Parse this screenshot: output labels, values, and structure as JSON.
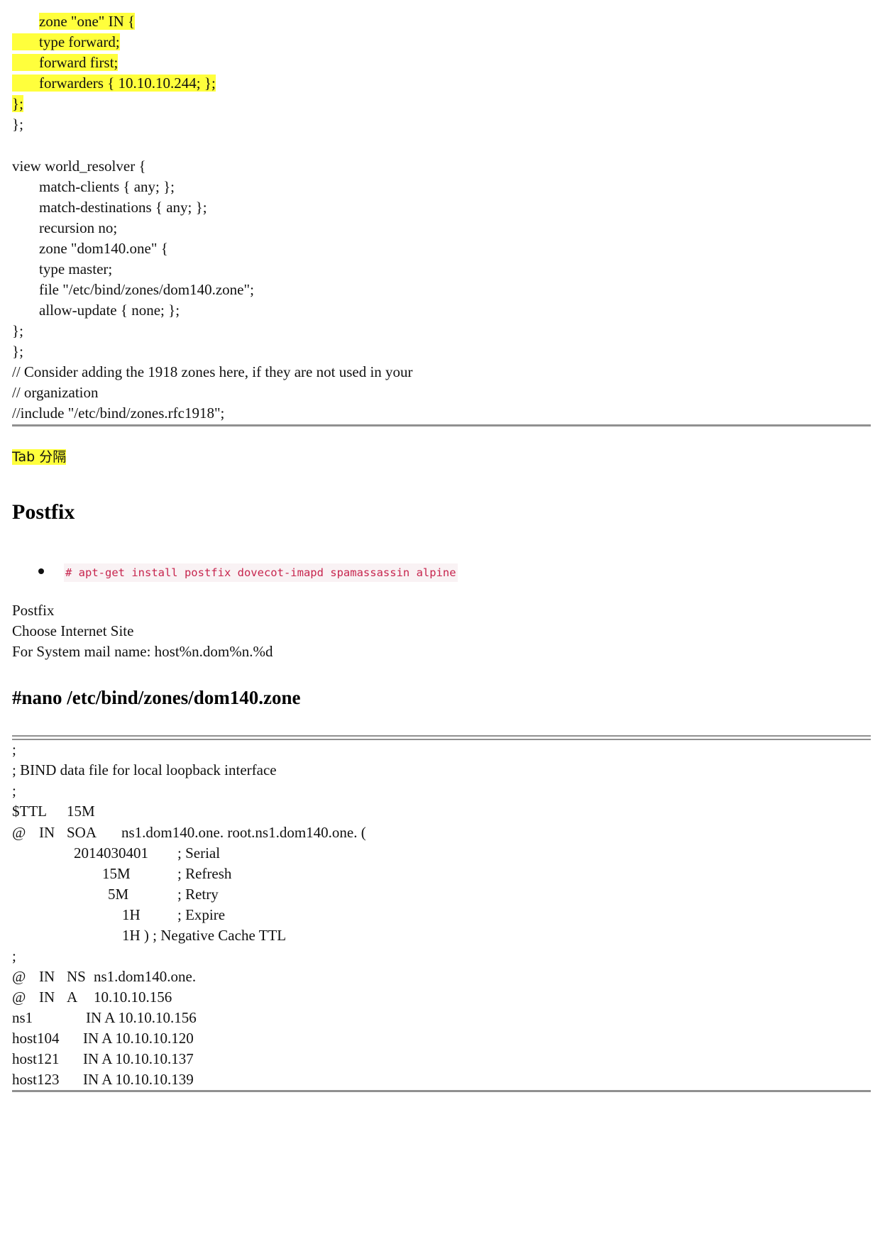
{
  "named_conf_tail": {
    "lines": [
      "zone \"one\" IN {",
      "type forward;",
      "forward first;",
      "forwarders { 10.10.10.244; };",
      "};",
      "};",
      "view world_resolver {",
      "match-clients { any; };",
      "match-destinations { any; };",
      "recursion no;",
      "zone \"dom140.one\" {",
      "type master;",
      "file \"/etc/bind/zones/dom140.zone\";",
      "allow-update { none; };",
      "};",
      "};",
      "// Consider adding the 1918 zones here, if they are not used in your",
      "// organization",
      "//include \"/etc/bind/zones.rfc1918\";"
    ]
  },
  "tab_note": "Tab 分隔",
  "postfix_section": {
    "heading": "Postfix",
    "install_command": "# apt-get install postfix dovecot-imapd spamassassin alpine",
    "lines": [
      "Postfix",
      "Choose Internet Site",
      "For System mail name: host%n.dom%n.%d"
    ]
  },
  "zone_file_section": {
    "heading": "#nano /etc/bind/zones/dom140.zone",
    "comment_lines": [
      ";",
      "; BIND data file for local loopback interface",
      ";"
    ],
    "ttl": {
      "key": "$TTL",
      "value": "15M"
    },
    "soa": {
      "at": "@",
      "class": "IN",
      "type": "SOA",
      "value": "ns1.dom140.one. root.ns1.dom140.one. ("
    },
    "soa_fields": [
      {
        "value": "2014030401",
        "comment": "; Serial"
      },
      {
        "value": "15M",
        "comment": "; Refresh"
      },
      {
        "value": "5M",
        "comment": "; Retry"
      },
      {
        "value": "1H",
        "comment": "; Expire"
      }
    ],
    "soa_last": "1H ) ; Negative Cache TTL",
    "separator": ";",
    "records": [
      {
        "name": "@",
        "class": "IN",
        "type": "NS",
        "value": "ns1.dom140.one."
      },
      {
        "name": "@",
        "class": "IN",
        "type": "A",
        "value": "10.10.10.156"
      }
    ],
    "hosts": [
      {
        "name": "ns1",
        "record": "IN A 10.10.10.156"
      },
      {
        "name": "host104",
        "record": "IN A 10.10.10.120"
      },
      {
        "name": "host121",
        "record": "IN A 10.10.10.137"
      },
      {
        "name": "host123",
        "record": "IN A 10.10.10.139"
      }
    ]
  }
}
